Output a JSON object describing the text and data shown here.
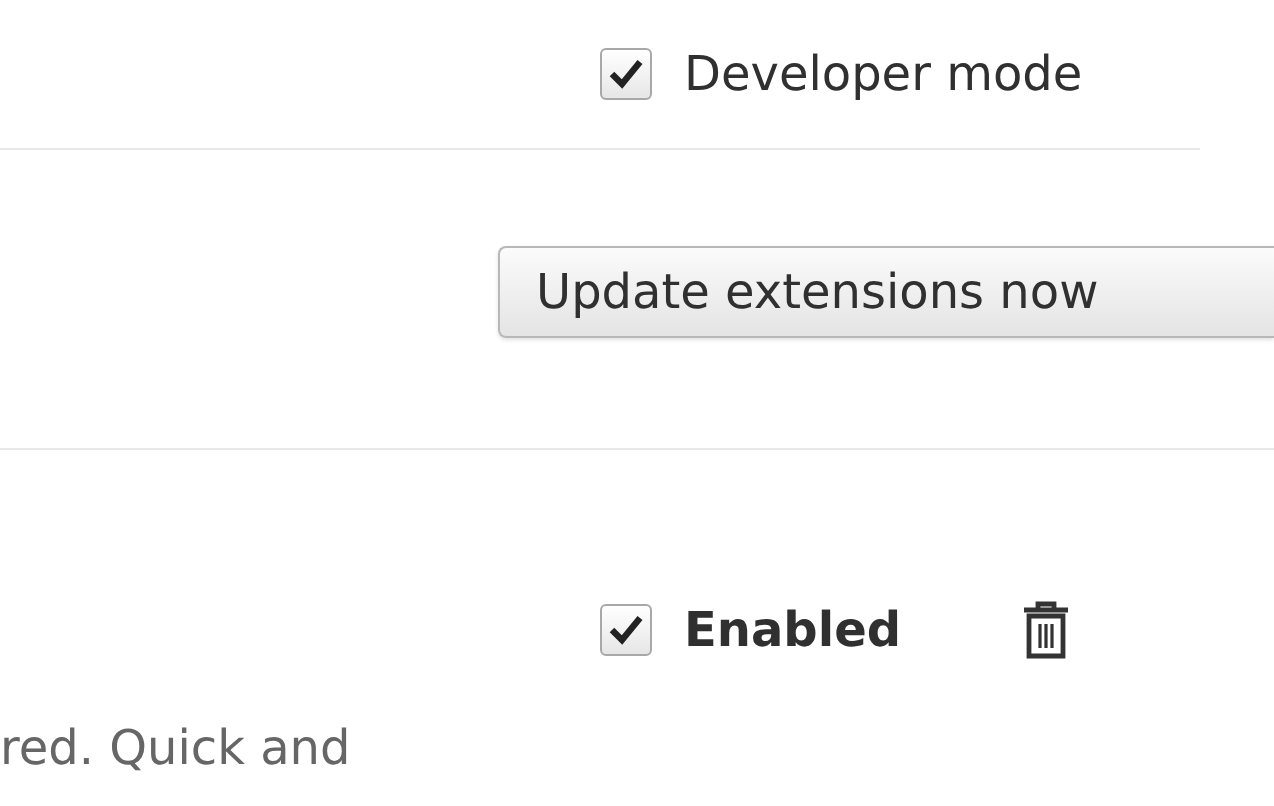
{
  "developer_mode": {
    "label": "Developer mode",
    "checked": true
  },
  "update_button": {
    "label": "Update extensions now"
  },
  "extension": {
    "enabled_label": "Enabled",
    "enabled": true,
    "description": "red. Quick and"
  }
}
